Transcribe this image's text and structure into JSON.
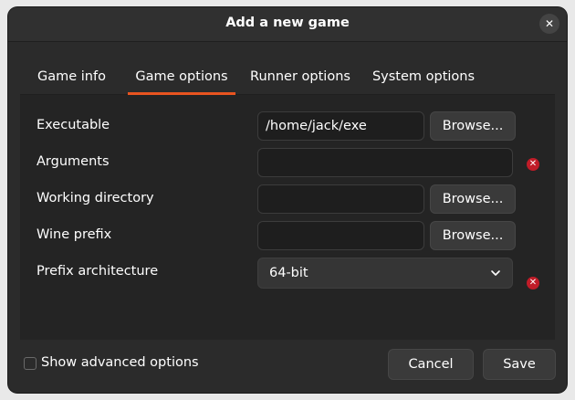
{
  "window": {
    "title": "Add a new game",
    "close_glyph": "✕"
  },
  "tabs": [
    {
      "label": "Game info",
      "active": false
    },
    {
      "label": "Game options",
      "active": true
    },
    {
      "label": "Runner options",
      "active": false
    },
    {
      "label": "System options",
      "active": false
    }
  ],
  "fields": {
    "executable": {
      "label": "Executable",
      "value": "/home/jack/exe",
      "button": "Browse..."
    },
    "arguments": {
      "label": "Arguments",
      "value": ""
    },
    "working_directory": {
      "label": "Working directory",
      "value": "",
      "button": "Browse..."
    },
    "wine_prefix": {
      "label": "Wine prefix",
      "value": "",
      "button": "Browse..."
    },
    "prefix_architecture": {
      "label": "Prefix architecture",
      "selected": "64-bit"
    }
  },
  "footer": {
    "advanced_label": "Show advanced options",
    "advanced_checked": false,
    "cancel_label": "Cancel",
    "save_label": "Save"
  },
  "icons": {
    "clear": "clear-icon",
    "dropdown": "chevron-down-icon",
    "close": "close-icon"
  },
  "colors": {
    "accent": "#e95420",
    "clear_badge": "#c01c28",
    "background": "#2b2b2b",
    "panel": "#242424"
  }
}
